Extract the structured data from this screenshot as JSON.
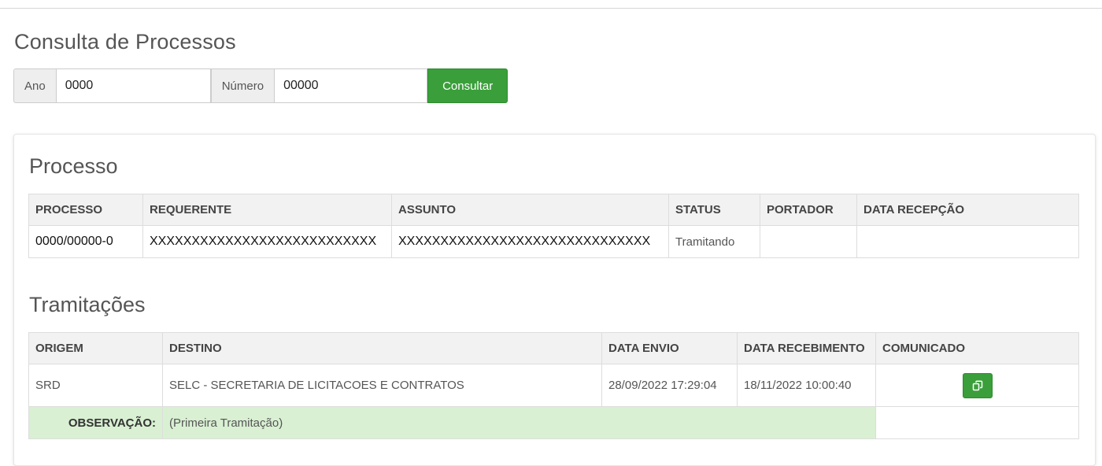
{
  "page_title": "Consulta de Processos",
  "search": {
    "ano_label": "Ano",
    "ano_value": "0000",
    "numero_label": "Número",
    "numero_value": "00000",
    "submit_label": "Consultar"
  },
  "processo": {
    "title": "Processo",
    "columns": [
      "PROCESSO",
      "REQUERENTE",
      "ASSUNTO",
      "STATUS",
      "PORTADOR",
      "DATA RECEPÇÃO"
    ],
    "row": {
      "processo": "0000/00000-0",
      "requerente": "XXXXXXXXXXXXXXXXXXXXXXXXXXX",
      "assunto": "XXXXXXXXXXXXXXXXXXXXXXXXXXXXXX",
      "status": "Tramitando",
      "portador": "",
      "data_recepcao": ""
    }
  },
  "tramitacoes": {
    "title": "Tramitações",
    "columns": [
      "ORIGEM",
      "DESTINO",
      "DATA ENVIO",
      "DATA RECEBIMENTO",
      "COMUNICADO"
    ],
    "rows": [
      {
        "origem": "SRD",
        "destino": "SELC - SECRETARIA DE LICITACOES E CONTRATOS",
        "data_envio": "28/09/2022 17:29:04",
        "data_recebimento": "18/11/2022 10:00:40",
        "comunicado_icon": "copy-icon",
        "observacao_label": "OBSERVAÇÃO:",
        "observacao": "(Primeira Tramitação)"
      }
    ]
  },
  "colors": {
    "accent_green": "#3a9f3a",
    "observation_bg": "#d9f0d3",
    "header_bg": "#f2f2f2"
  }
}
